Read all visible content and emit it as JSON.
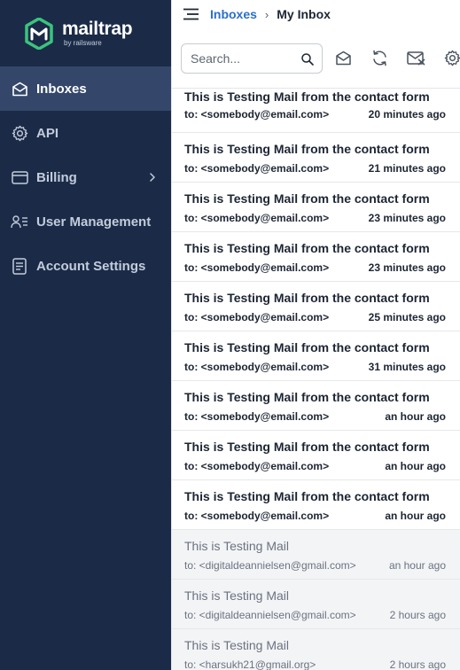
{
  "brand": {
    "name": "mailtrap",
    "sub": "by railsware",
    "accent": "#3ac47d"
  },
  "sidebar": {
    "items": [
      {
        "label": "Inboxes",
        "icon": "inbox-icon",
        "active": true
      },
      {
        "label": "API",
        "icon": "gear-icon"
      },
      {
        "label": "Billing",
        "icon": "card-icon",
        "chevron": true
      },
      {
        "label": "User Management",
        "icon": "users-icon"
      },
      {
        "label": "Account Settings",
        "icon": "document-icon"
      }
    ]
  },
  "breadcrumb": {
    "parent": "Inboxes",
    "separator": "›",
    "current": "My Inbox"
  },
  "search": {
    "placeholder": "Search..."
  },
  "messages": [
    {
      "subject": "This is Testing Mail from the contact form",
      "to": "to: <somebody@email.com>",
      "time": "20 minutes ago",
      "state": "unread"
    },
    {
      "subject": "This is Testing Mail from the contact form",
      "to": "to: <somebody@email.com>",
      "time": "21 minutes ago",
      "state": "unread"
    },
    {
      "subject": "This is Testing Mail from the contact form",
      "to": "to: <somebody@email.com>",
      "time": "23 minutes ago",
      "state": "unread"
    },
    {
      "subject": "This is Testing Mail from the contact form",
      "to": "to: <somebody@email.com>",
      "time": "23 minutes ago",
      "state": "unread"
    },
    {
      "subject": "This is Testing Mail from the contact form",
      "to": "to: <somebody@email.com>",
      "time": "25 minutes ago",
      "state": "unread"
    },
    {
      "subject": "This is Testing Mail from the contact form",
      "to": "to: <somebody@email.com>",
      "time": "31 minutes ago",
      "state": "unread"
    },
    {
      "subject": "This is Testing Mail from the contact form",
      "to": "to: <somebody@email.com>",
      "time": "an hour ago",
      "state": "unread"
    },
    {
      "subject": "This is Testing Mail from the contact form",
      "to": "to: <somebody@email.com>",
      "time": "an hour ago",
      "state": "unread"
    },
    {
      "subject": "This is Testing Mail from the contact form",
      "to": "to: <somebody@email.com>",
      "time": "an hour ago",
      "state": "unread"
    },
    {
      "subject": "This is Testing Mail",
      "to": "to: <digitaldeannielsen@gmail.com>",
      "time": "an hour ago",
      "state": "read"
    },
    {
      "subject": "This is Testing Mail",
      "to": "to: <digitaldeannielsen@gmail.com>",
      "time": "2 hours ago",
      "state": "read"
    },
    {
      "subject": "This is Testing Mail",
      "to": "to: <harsukh21@gmail.org>",
      "time": "2 hours ago",
      "state": "read"
    }
  ]
}
